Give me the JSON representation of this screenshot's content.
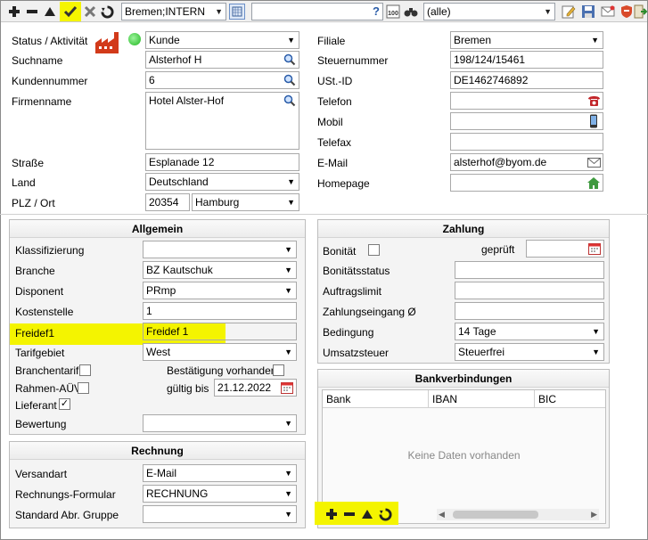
{
  "toolbar": {
    "location_combo": "Bremen;INTERN",
    "search_value": "",
    "filter_combo": "(alle)"
  },
  "header": {
    "status_label": "Status / Aktivität",
    "status_value": "Kunde",
    "suchname_label": "Suchname",
    "suchname_value": "Alsterhof H",
    "kundennummer_label": "Kundennummer",
    "kundennummer_value": "6",
    "firmenname_label": "Firmenname",
    "firmenname_value": "Hotel Alster-Hof",
    "strasse_label": "Straße",
    "strasse_value": "Esplanade 12",
    "land_label": "Land",
    "land_value": "Deutschland",
    "plz_ort_label": "PLZ / Ort",
    "plz_value": "20354",
    "ort_value": "Hamburg",
    "filiale_label": "Filiale",
    "filiale_value": "Bremen",
    "steuernummer_label": "Steuernummer",
    "steuernummer_value": "198/124/15461",
    "ust_label": "USt.-ID",
    "ust_value": "DE1462746892",
    "telefon_label": "Telefon",
    "telefon_value": "",
    "mobil_label": "Mobil",
    "mobil_value": "",
    "telefax_label": "Telefax",
    "telefax_value": "",
    "email_label": "E-Mail",
    "email_value": "alsterhof@byom.de",
    "homepage_label": "Homepage",
    "homepage_value": ""
  },
  "allgemein": {
    "title": "Allgemein",
    "klassifizierung_label": "Klassifizierung",
    "klassifizierung_value": "",
    "branche_label": "Branche",
    "branche_value": "BZ Kautschuk",
    "disponent_label": "Disponent",
    "disponent_value": "PRmp",
    "kostenstelle_label": "Kostenstelle",
    "kostenstelle_value": "1",
    "freidef_label": "Freidef1",
    "freidef_value": "Freidef 1",
    "tarifgebiet_label": "Tarifgebiet",
    "tarifgebiet_value": "West",
    "branchentarif_label": "Branchentarif",
    "rahmen_label": "Rahmen-AÜV",
    "lieferant_label": "Lieferant",
    "bestaetigung_label": "Bestätigung vorhanden",
    "gueltig_label": "gültig bis",
    "gueltig_value": "21.12.2022",
    "bewertung_label": "Bewertung",
    "bewertung_value": ""
  },
  "rechnung": {
    "title": "Rechnung",
    "versandart_label": "Versandart",
    "versandart_value": "E-Mail",
    "formular_label": "Rechnungs-Formular",
    "formular_value": "RECHNUNG",
    "abr_gruppe_label": "Standard Abr. Gruppe",
    "abr_gruppe_value": ""
  },
  "zahlung": {
    "title": "Zahlung",
    "bonitaet_label": "Bonität",
    "geprueft_label": "geprüft",
    "geprueft_value": "",
    "bonitaetsstatus_label": "Bonitätsstatus",
    "bonitaetsstatus_value": "",
    "auftragslimit_label": "Auftragslimit",
    "auftragslimit_value": "",
    "zahlungseingang_label": "Zahlungseingang Ø",
    "zahlungseingang_value": "",
    "bedingung_label": "Bedingung",
    "bedingung_value": "14 Tage",
    "umsatzsteuer_label": "Umsatzsteuer",
    "umsatzsteuer_value": "Steuerfrei"
  },
  "bank": {
    "title": "Bankverbindungen",
    "columns": [
      "Bank",
      "IBAN",
      "BIC"
    ],
    "empty_text": "Keine Daten vorhanden"
  },
  "state": {
    "branchentarif": false,
    "rahmen": false,
    "lieferant": true,
    "bestaetigung": false,
    "bonitaet": false
  },
  "colors": {
    "highlight": "#f4f400",
    "status_green": "#2ecc2e",
    "factory_red": "#d23a1a"
  },
  "icons": {
    "toolbar": [
      "add-icon",
      "minus-icon",
      "up-triangle-icon",
      "checkmark-icon",
      "delete-x-icon",
      "refresh-icon"
    ],
    "bank_toolbar": [
      "add-icon",
      "minus-icon",
      "up-triangle-icon",
      "refresh-icon"
    ]
  }
}
